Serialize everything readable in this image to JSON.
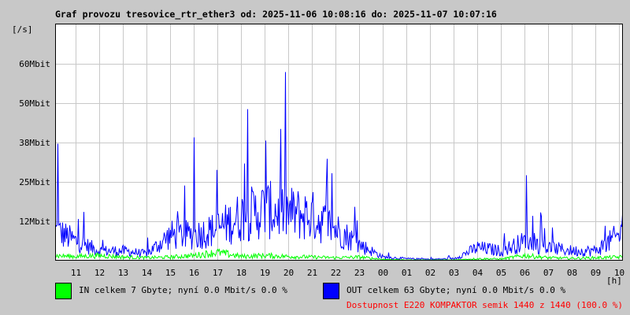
{
  "chart_data": {
    "type": "line",
    "title": "Graf provozu tresovice_rtr_ether3 od: 2025-11-06 10:08:16 do: 2025-11-07 10:07:16",
    "ylabel": "[/s]",
    "xlabel": "[h]",
    "y_unit": "Mbit",
    "ylim": [
      0,
      75
    ],
    "y_ticks": [
      {
        "value": 12.5,
        "label": "12Mbit"
      },
      {
        "value": 25,
        "label": "25Mbit"
      },
      {
        "value": 37.5,
        "label": "38Mbit"
      },
      {
        "value": 50,
        "label": "50Mbit"
      },
      {
        "value": 62.5,
        "label": "60Mbit"
      }
    ],
    "x_ticks": [
      "11",
      "12",
      "13",
      "14",
      "15",
      "16",
      "17",
      "18",
      "19",
      "20",
      "21",
      "22",
      "23",
      "00",
      "01",
      "02",
      "03",
      "04",
      "05",
      "06",
      "07",
      "08",
      "09",
      "10"
    ],
    "grid": true,
    "series": [
      {
        "name": "IN",
        "color": "#00ff00",
        "hourly_mbit": [
          1.5,
          1.2,
          1.5,
          1.0,
          0.8,
          1.0,
          1.5,
          2.5,
          1.2,
          1.5,
          1.2,
          1.0,
          0.8,
          1.0,
          0.3,
          0.1,
          0.1,
          0.1,
          0.5,
          0.4,
          1.5,
          0.8,
          0.6,
          0.8,
          1.0
        ]
      },
      {
        "name": "OUT",
        "color": "#0000ff",
        "hourly_mbit": [
          10,
          6,
          3,
          3,
          2,
          8,
          8,
          10,
          14,
          16,
          15,
          14,
          10,
          5,
          1,
          0.5,
          0.3,
          0.5,
          4,
          3,
          6,
          4,
          3,
          3,
          8
        ]
      }
    ]
  },
  "title": "Graf provozu tresovice_rtr_ether3 od: 2025-11-06 10:08:16 do: 2025-11-07 10:07:16",
  "legend": {
    "in": {
      "text": "IN celkem 7 Gbyte; nyní   0.0 Mbit/s 0.0 %",
      "color": "#00ff00"
    },
    "out": {
      "text": "OUT celkem 63 Gbyte; nyní   0.0 Mbit/s 0.0 %",
      "color": "#0000ff"
    },
    "availability": "Dostupnost E220 KOMPAKTOR semik 1440 z 1440 (100.0 %)"
  }
}
